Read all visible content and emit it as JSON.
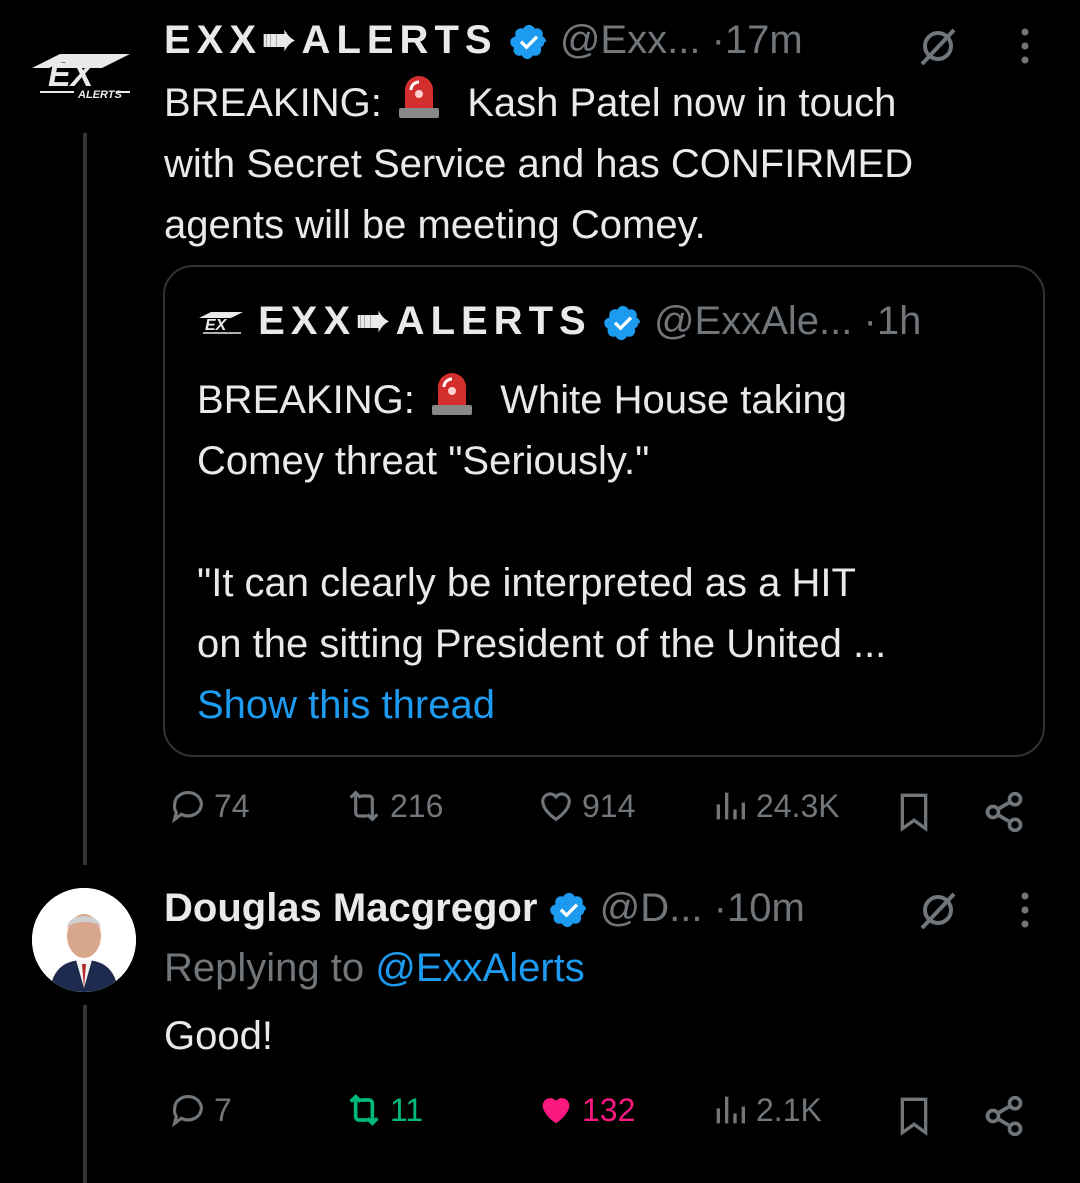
{
  "tweet1": {
    "display_name": "EXX➠ALERTS",
    "handle": "@Exx...",
    "time": "17m",
    "avatar_text": "EX",
    "avatar_sub": "ALERTS",
    "text_before": "BREAKING:",
    "text_line1_after": "Kash Patel now in touch",
    "text_line2": "with Secret Service and has CONFIRMED",
    "text_line3": "agents will be  meeting Comey.",
    "stats": {
      "replies": "74",
      "reposts": "216",
      "likes": "914",
      "views": "24.3K"
    }
  },
  "quote": {
    "display_name": "EXX➠ALERTS",
    "handle": "@ExxAle...",
    "time": "1h",
    "text_before": "BREAKING:",
    "text_line1_after": "White House taking",
    "text_line2": "Comey threat \"Seriously.\"",
    "text_line3": "\"It can clearly be interpreted as a HIT",
    "text_line4": "on the sitting President of the United ...",
    "show_thread": "Show this thread"
  },
  "tweet2": {
    "display_name": "Douglas Macgregor",
    "handle": "@D...",
    "time": "10m",
    "replying_prefix": "Replying to",
    "replying_handle": "@ExxAlerts",
    "text": "Good!",
    "stats": {
      "replies": "7",
      "reposts": "11",
      "likes": "132",
      "views": "2.1K"
    }
  },
  "colors": {
    "background": "#000000",
    "text": "#e7e9ea",
    "muted": "#71767b",
    "accent_blue": "#1d9bf0",
    "repost_green": "#00ba7c",
    "like_pink": "#f91880"
  },
  "icons": [
    "verified-badge-icon",
    "grok-icon",
    "more-icon",
    "reply-icon",
    "repost-icon",
    "like-icon",
    "views-icon",
    "bookmark-icon",
    "share-icon",
    "siren-emoji-icon"
  ]
}
